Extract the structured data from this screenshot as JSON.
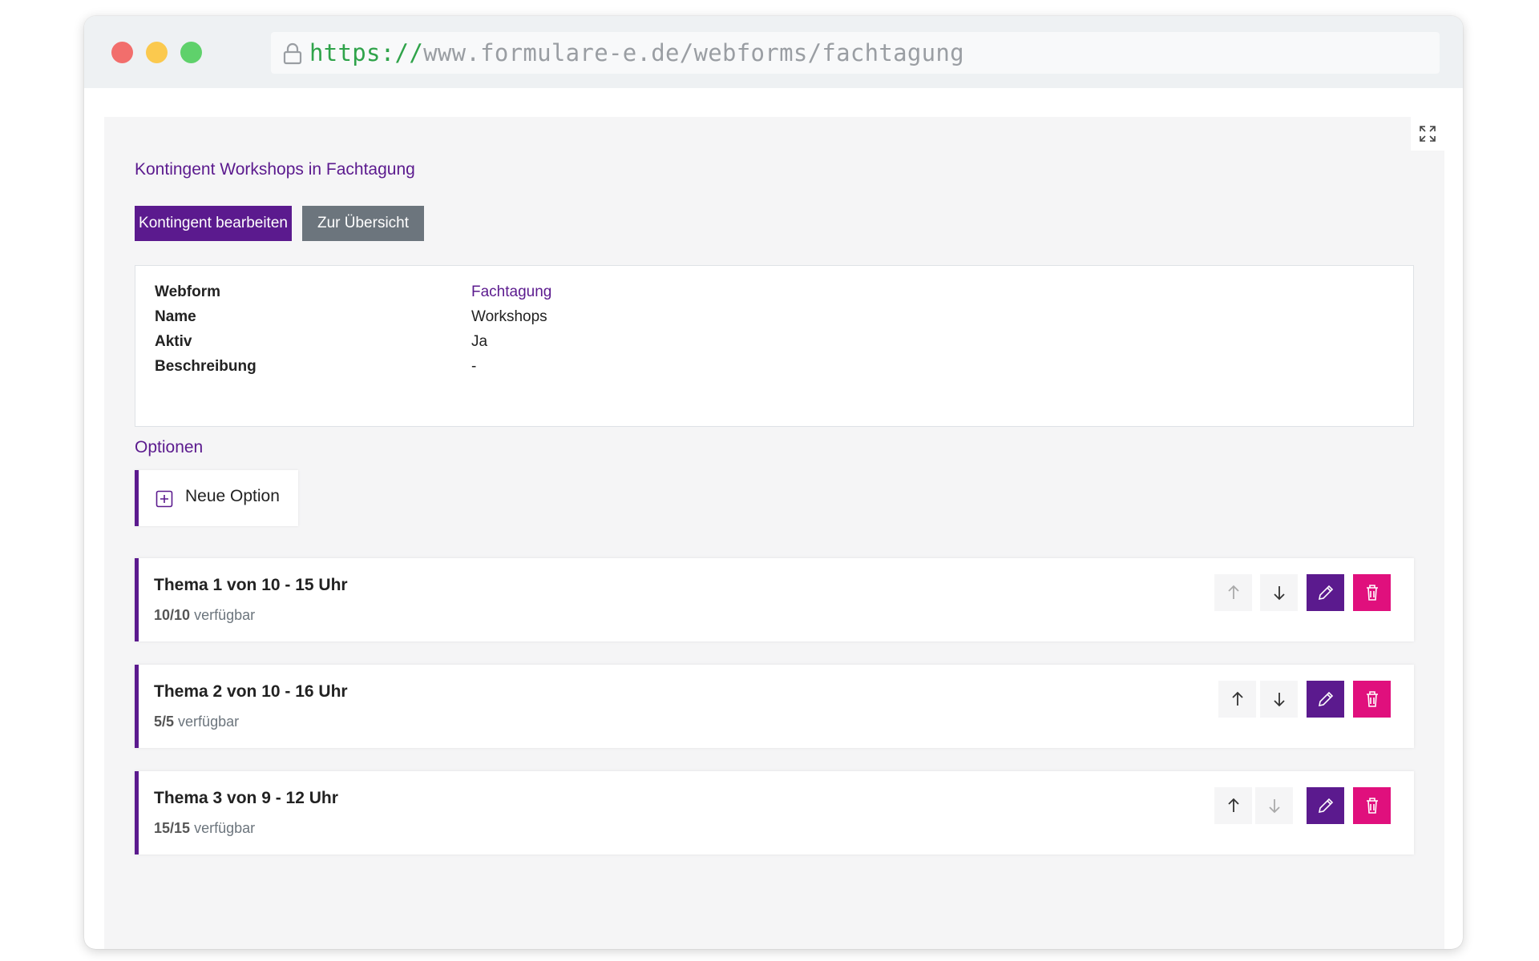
{
  "browser": {
    "url_scheme": "https://",
    "url_rest": "www.formulare-e.de/webforms/fachtagung"
  },
  "page": {
    "title": "Kontingent Workshops in Fachtagung",
    "edit_button": "Kontingent bearbeiten",
    "overview_button": "Zur Übersicht"
  },
  "info": {
    "rows": [
      {
        "label": "Webform",
        "value": "Fachtagung"
      },
      {
        "label": "Name",
        "value": "Workshops"
      },
      {
        "label": "Aktiv",
        "value": "Ja"
      },
      {
        "label": "Beschreibung",
        "value": "-"
      }
    ]
  },
  "options": {
    "section_title": "Optionen",
    "new_option_label": "Neue Option",
    "available_suffix": "verfügbar",
    "items": [
      {
        "title": "Thema 1 von 10 - 15 Uhr",
        "count": "10/10"
      },
      {
        "title": "Thema 2 von 10 - 16 Uhr",
        "count": "5/5"
      },
      {
        "title": "Thema 3 von 9 - 12 Uhr",
        "count": "15/15"
      }
    ]
  },
  "colors": {
    "brand": "#5b1a8e",
    "danger": "#e0107d",
    "secondary": "#6c757d"
  }
}
